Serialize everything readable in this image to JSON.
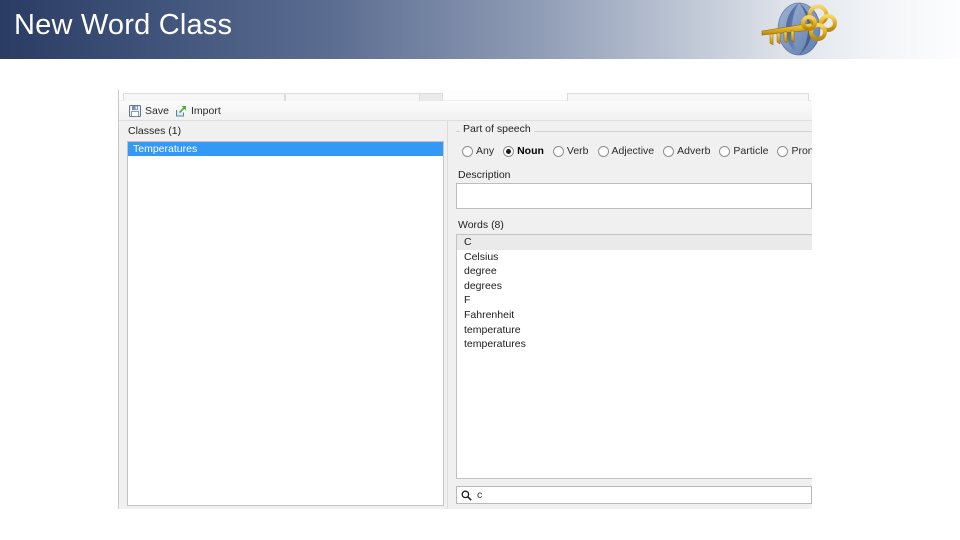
{
  "slide": {
    "title": "New Word Class",
    "logo_icon": "gold-key-globe-logo"
  },
  "app": {
    "toolbar": {
      "save_label": "Save",
      "save_icon": "floppy-disk-icon",
      "import_label": "Import",
      "import_icon": "import-arrow-icon"
    },
    "left_pane": {
      "classes_label": "Classes (1)",
      "classes": [
        {
          "name": "Temperatures",
          "selected": true
        }
      ]
    },
    "right_pane": {
      "part_of_speech": {
        "legend": "Part of speech",
        "options": [
          {
            "label": "Any",
            "checked": false
          },
          {
            "label": "Noun",
            "checked": true
          },
          {
            "label": "Verb",
            "checked": false
          },
          {
            "label": "Adjective",
            "checked": false
          },
          {
            "label": "Adverb",
            "checked": false
          },
          {
            "label": "Particle",
            "checked": false
          },
          {
            "label": "Pronoun",
            "checked": false
          }
        ]
      },
      "description": {
        "label": "Description",
        "value": "",
        "placeholder": ""
      },
      "words": {
        "label": "Words (8)",
        "items": [
          {
            "text": "C",
            "highlight": true
          },
          {
            "text": "Celsius",
            "highlight": false
          },
          {
            "text": "degree",
            "highlight": false
          },
          {
            "text": "degrees",
            "highlight": false
          },
          {
            "text": "F",
            "highlight": false
          },
          {
            "text": "Fahrenheit",
            "highlight": false
          },
          {
            "text": "temperature",
            "highlight": false
          },
          {
            "text": "temperatures",
            "highlight": false
          }
        ]
      },
      "search": {
        "icon": "search-icon",
        "value": "c",
        "placeholder": ""
      }
    }
  },
  "colors": {
    "title_gradient_start": "#2b3c63",
    "title_gradient_end": "#fdfdfe",
    "selection_blue": "#3399f5",
    "logo_gold": "#e8b92e",
    "logo_blue": "#4a6fa8"
  }
}
